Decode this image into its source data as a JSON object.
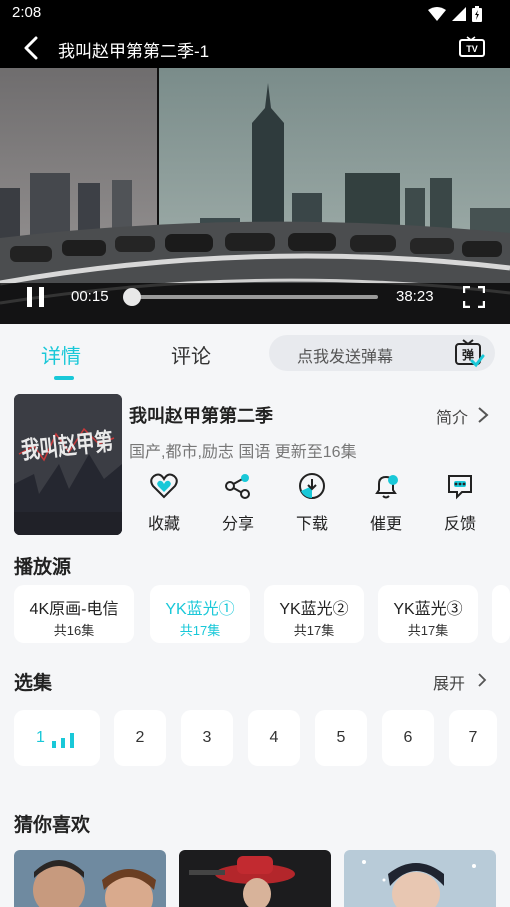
{
  "status": {
    "time": "2:08"
  },
  "player": {
    "title": "我叫赵甲第第二季-1",
    "current_time": "00:15",
    "duration": "38:23",
    "progress": 0.0065
  },
  "tabs": {
    "detail": "详情",
    "comments": "评论"
  },
  "danmaku": {
    "placeholder": "点我发送弹幕",
    "icon_text": "弹"
  },
  "show": {
    "title": "我叫赵甲第第二季",
    "intro_label": "简介",
    "meta": "国产,都市,励志 国语 更新至16集",
    "poster_text": "我叫赵甲第"
  },
  "actions": [
    {
      "label": "收藏",
      "icon": "heart-icon"
    },
    {
      "label": "分享",
      "icon": "share-icon"
    },
    {
      "label": "下载",
      "icon": "download-icon"
    },
    {
      "label": "催更",
      "icon": "bell-icon"
    },
    {
      "label": "反馈",
      "icon": "feedback-icon"
    }
  ],
  "sources": {
    "title": "播放源",
    "items": [
      {
        "name": "4K原画-电信",
        "count": "共16集"
      },
      {
        "name": "YK蓝光①",
        "count": "共17集"
      },
      {
        "name": "YK蓝光②",
        "count": "共17集"
      },
      {
        "name": "YK蓝光③",
        "count": "共17集"
      }
    ],
    "active_index": 1
  },
  "episodes": {
    "title": "选集",
    "expand_label": "展开",
    "items": [
      "1",
      "2",
      "3",
      "4",
      "5",
      "6",
      "7"
    ],
    "active_index": 0
  },
  "recommend": {
    "title": "猜你喜欢"
  },
  "colors": {
    "accent": "#19c8d8",
    "background": "#f5f6f8"
  }
}
